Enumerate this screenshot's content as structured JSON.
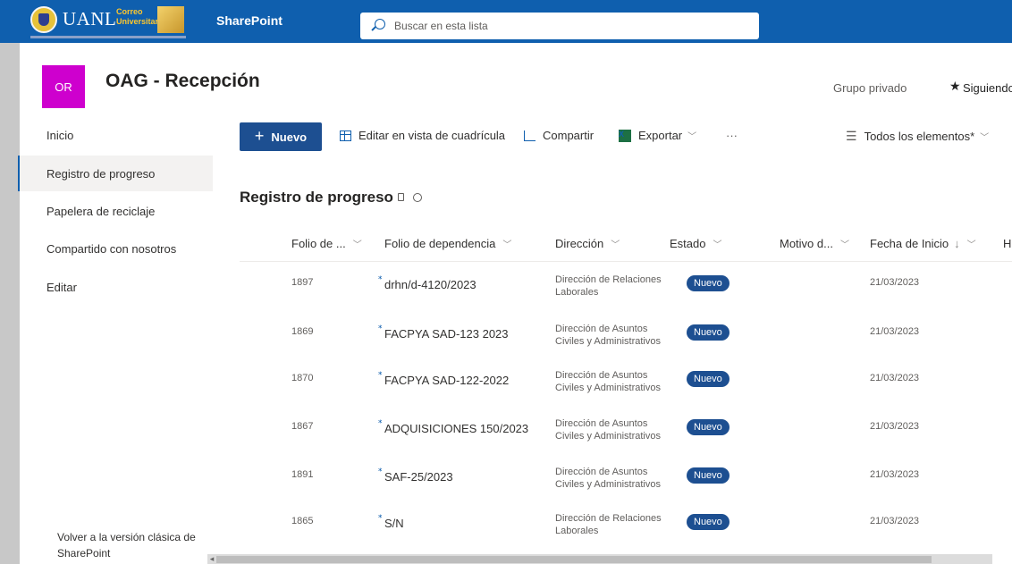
{
  "suitebar": {
    "logo_text": "UANL",
    "logo_sub1": "Correo",
    "logo_sub2": "Universitario",
    "app_name": "SharePoint",
    "search_placeholder": "Buscar en esta lista"
  },
  "site": {
    "logo_initials": "OR",
    "title": "OAG - Recepción",
    "privacy": "Grupo privado",
    "follow": "Siguiendo"
  },
  "nav": {
    "items": [
      "Inicio",
      "Registro de progreso",
      "Papelera de reciclaje",
      "Compartido con nosotros",
      "Editar"
    ],
    "active_index": 1,
    "bottom_link": "Volver a la versión clásica de SharePoint"
  },
  "commands": {
    "new": "Nuevo",
    "grid_edit": "Editar en vista de cuadrícula",
    "share": "Compartir",
    "export": "Exportar",
    "more": "···",
    "view": "Todos los elementos*"
  },
  "list": {
    "title": "Registro de progreso",
    "columns": [
      "Folio de ...",
      "Folio de dependencia",
      "Dirección",
      "Estado",
      "Motivo d...",
      "Fecha de Inicio",
      "H"
    ],
    "sort_indicator": "↓",
    "rows": [
      {
        "folio": "1897",
        "dependencia": "drhn/d-4120/2023",
        "direccion": "Dirección de Relaciones Laborales",
        "estado": "Nuevo",
        "fecha": "21/03/2023"
      },
      {
        "folio": "1869",
        "dependencia": "FACPYA SAD-123 2023",
        "direccion": "Dirección de Asuntos Civiles y Administrativos",
        "estado": "Nuevo",
        "fecha": "21/03/2023"
      },
      {
        "folio": "1870",
        "dependencia": "FACPYA SAD-122-2022",
        "direccion": "Dirección de Asuntos Civiles y Administrativos",
        "estado": "Nuevo",
        "fecha": "21/03/2023"
      },
      {
        "folio": "1867",
        "dependencia": "ADQUISICIONES 150/2023",
        "direccion": "Dirección de Asuntos Civiles y Administrativos",
        "estado": "Nuevo",
        "fecha": "21/03/2023"
      },
      {
        "folio": "1891",
        "dependencia": "SAF-25/2023",
        "direccion": "Dirección de Asuntos Civiles y Administrativos",
        "estado": "Nuevo",
        "fecha": "21/03/2023"
      },
      {
        "folio": "1865",
        "dependencia": "S/N",
        "direccion": "Dirección de Relaciones Laborales",
        "estado": "Nuevo",
        "fecha": "21/03/2023"
      }
    ]
  },
  "colors": {
    "suitebar": "#0f5fae",
    "primary_button": "#1d4f91",
    "site_logo": "#ce00ce",
    "badge": "#1d4f91"
  }
}
